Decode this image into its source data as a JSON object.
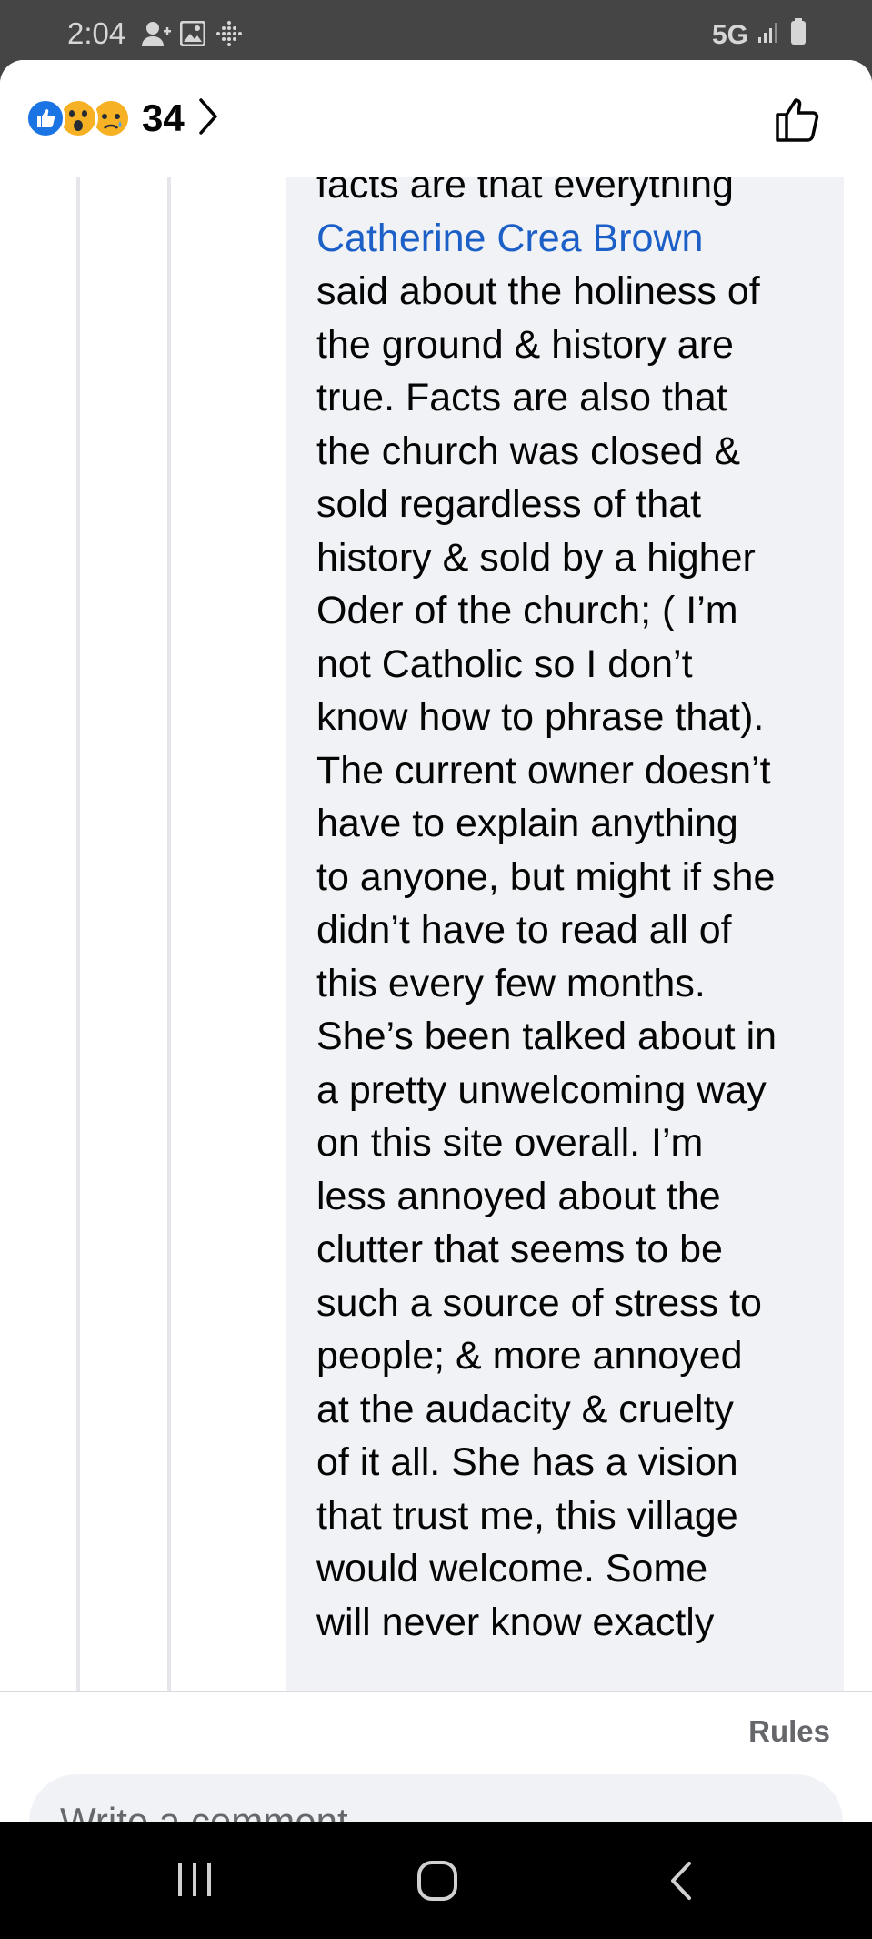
{
  "status_bar": {
    "time": "2:04",
    "network": "5G",
    "left_icons": [
      "person-add-icon",
      "image-icon",
      "dots-grid-icon"
    ],
    "right_icons": [
      "signal-icon",
      "battery-icon"
    ]
  },
  "header": {
    "reaction_count": "34",
    "reactions": [
      "like",
      "wow",
      "sad"
    ],
    "reaction_colors": {
      "like": "#1b74e4",
      "wow": "#f7b125",
      "sad": "#f7b125"
    }
  },
  "comment": {
    "text_before": "facts are that everything\n",
    "mention": "Catherine Crea Brown",
    "text_after": "\nsaid about the holiness of\nthe ground & history are\ntrue.  Facts are also that\nthe church was closed &\nsold regardless of that\nhistory & sold by a higher\nOder of the church; ( I’m\nnot Catholic so I don’t\nknow how to phrase that).\nThe current owner doesn’t\nhave to explain anything\nto anyone, but might if she\ndidn’t have to read all of\nthis every few months.\nShe’s been talked about in\na pretty unwelcoming way\non this site overall.  I’m\nless annoyed about the\nclutter that seems to be\nsuch a source of stress to\npeople; & more annoyed\nat the audacity & cruelty\nof it all.  She has a vision\nthat trust me, this village\nwould welcome.  Some\nwill never know exactly"
  },
  "footer": {
    "rules_label": "Rules",
    "comment_placeholder": "Write a comment…"
  },
  "nav": {
    "buttons": [
      "recent-apps",
      "home",
      "back"
    ]
  },
  "colors": {
    "accent": "#1b74e4",
    "mention": "#1b5fc7",
    "bubble": "#f0f2f5"
  }
}
